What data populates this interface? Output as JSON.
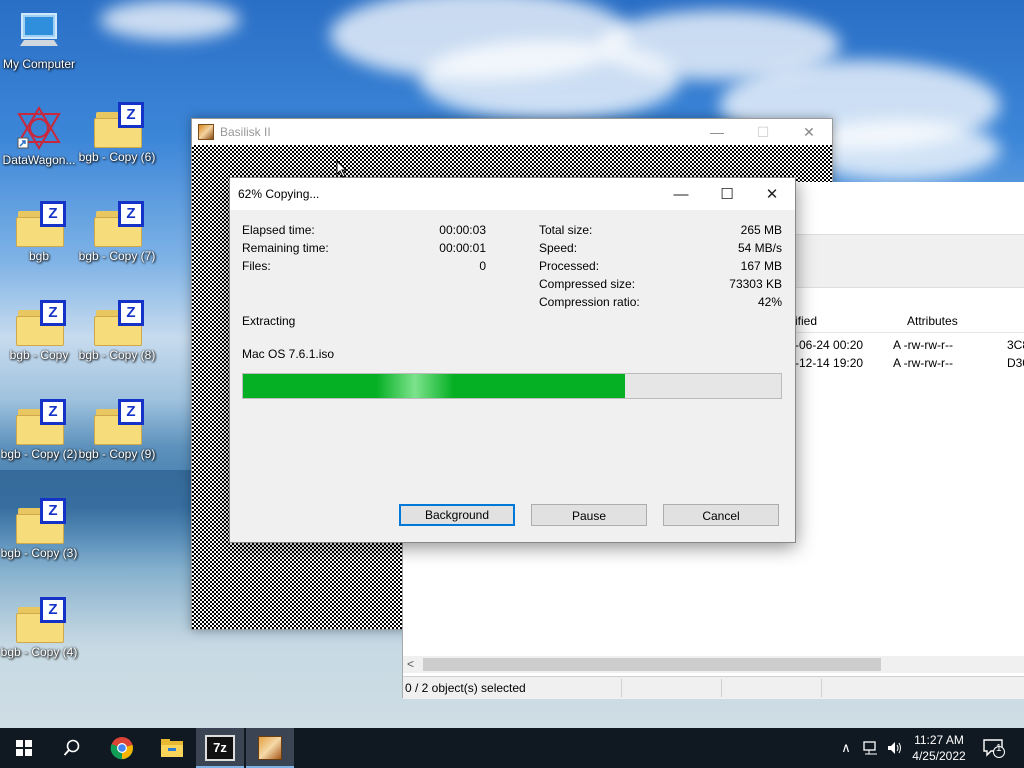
{
  "desktop": {
    "icons": [
      {
        "label": "My Computer",
        "type": "computer"
      },
      {
        "label": "DataWagon...",
        "type": "shortcut"
      },
      {
        "label": "bgb",
        "type": "folder"
      },
      {
        "label": "bgb - Copy",
        "type": "folder"
      },
      {
        "label": "bgb - Copy (2)",
        "type": "folder"
      },
      {
        "label": "bgb - Copy (3)",
        "type": "folder"
      },
      {
        "label": "bgb - Copy (4)",
        "type": "folder"
      },
      {
        "label": "bgb - Copy (6)",
        "type": "folder"
      },
      {
        "label": "bgb - Copy (7)",
        "type": "folder"
      },
      {
        "label": "bgb - Copy (8)",
        "type": "folder"
      },
      {
        "label": "bgb - Copy (9)",
        "type": "folder"
      }
    ]
  },
  "basilisk": {
    "title": "Basilisk II",
    "minimize_glyph": "—",
    "maximize_glyph": "☐",
    "close_glyph": "✕"
  },
  "file_manager": {
    "columns": {
      "modified": "ified",
      "attributes": "Attributes"
    },
    "rows": [
      {
        "modified": "-06-24 00:20",
        "attributes": "A -rw-rw-r--",
        "extra": "3C8"
      },
      {
        "modified": "-12-14 19:20",
        "attributes": "A -rw-rw-r--",
        "extra": "D30"
      }
    ],
    "scroll_left_glyph": "<",
    "status": "0 / 2 object(s) selected"
  },
  "progress_dialog": {
    "title": "62% Copying...",
    "minimize_glyph": "—",
    "maximize_glyph": "☐",
    "close_glyph": "✕",
    "left_stats": [
      {
        "label": "Elapsed time:",
        "value": "00:00:03"
      },
      {
        "label": "Remaining time:",
        "value": "00:00:01"
      },
      {
        "label": "Files:",
        "value": "0"
      }
    ],
    "right_stats": [
      {
        "label": "Total size:",
        "value": "265 MB"
      },
      {
        "label": "Speed:",
        "value": "54 MB/s"
      },
      {
        "label": "Processed:",
        "value": "167 MB"
      },
      {
        "label": "Compressed size:",
        "value": "73303 KB"
      },
      {
        "label": "Compression ratio:",
        "value": "42%"
      }
    ],
    "operation": "Extracting",
    "current_file": "Mac OS 7.6.1.iso",
    "progress_fraction": 0.71,
    "buttons": {
      "background": "Background",
      "pause": "Pause",
      "cancel": "Cancel"
    }
  },
  "taskbar": {
    "apps": [
      "start-icon",
      "search-icon",
      "chrome-icon",
      "file-explorer-icon",
      "7zip-icon",
      "basilisk-icon"
    ],
    "sevenzip_label": "7z",
    "tray": {
      "chevron": "∧",
      "network": "🖧",
      "volume": "🔊)",
      "time": "11:27 AM",
      "date": "4/25/2022",
      "notification_count": "1"
    }
  },
  "colors": {
    "progress_green": "#06b025",
    "accent_blue": "#0078d7",
    "taskbar": "#101922"
  }
}
